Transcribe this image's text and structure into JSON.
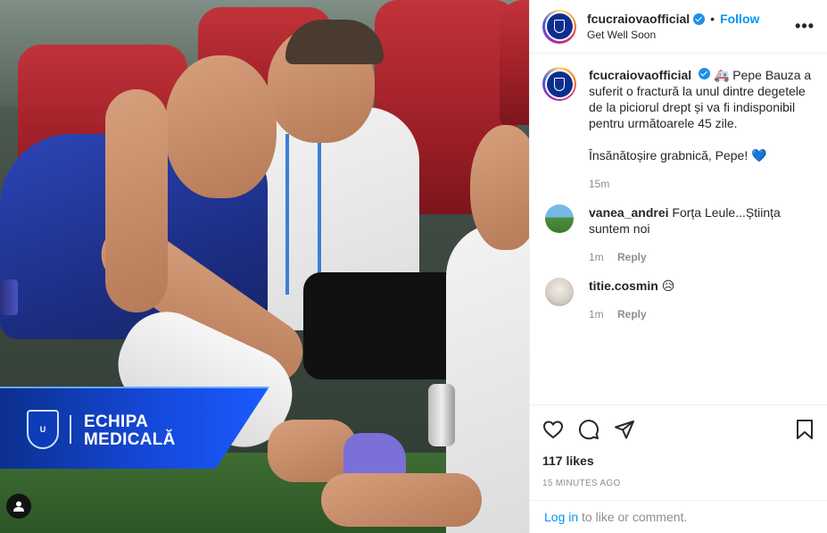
{
  "post": {
    "account": "fcucraiovaofficial",
    "follow_label": "Follow",
    "separator": "•",
    "location": "Get Well Soon",
    "more_label": "•••"
  },
  "image": {
    "banner_line1": "ECHIPA",
    "banner_line2": "MEDICALĂ",
    "crest_text": "U"
  },
  "caption": {
    "username": "fcucraiovaofficial",
    "text": "🚑 Pepe Bauza a suferit o fractură la unul dintre degetele de la piciorul drept și va fi indisponibil pentru următoarele 45 zile.\n\nÎnsănătoșire grabnică, Pepe! 💙",
    "time": "15m"
  },
  "comments": [
    {
      "username": "vanea_andrei",
      "text": "Forța Leule...Știința suntem noi",
      "time": "1m",
      "reply_label": "Reply"
    },
    {
      "username": "titie.cosmin",
      "text": "😥",
      "time": "1m",
      "reply_label": "Reply"
    }
  ],
  "stats": {
    "likes": "117 likes",
    "timestamp": "15 MINUTES AGO"
  },
  "login": {
    "link": "Log in",
    "rest": " to like or comment."
  },
  "colors": {
    "accent": "#0095f6",
    "verified": "#1f8fe8",
    "muted": "#8e8e8e",
    "text": "#262626"
  }
}
